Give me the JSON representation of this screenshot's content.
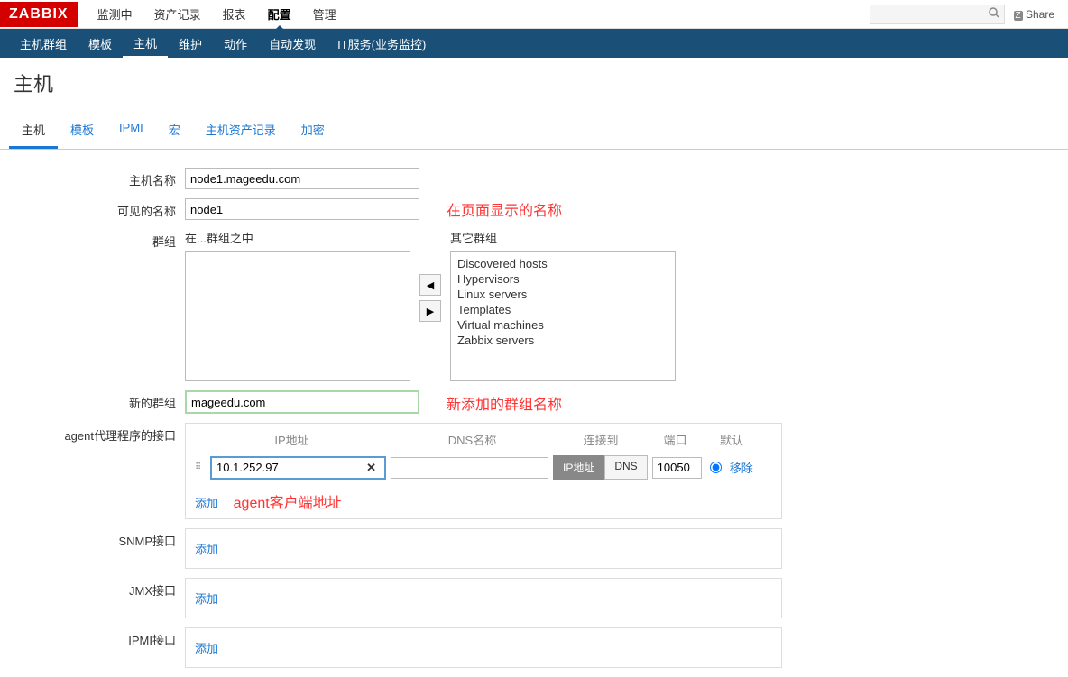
{
  "brand": "ZABBIX",
  "topnav": [
    "监测中",
    "资产记录",
    "报表",
    "配置",
    "管理"
  ],
  "topnav_active": 3,
  "share_label": "Share",
  "subnav": [
    "主机群组",
    "模板",
    "主机",
    "维护",
    "动作",
    "自动发现",
    "IT服务(业务监控)"
  ],
  "subnav_active": 2,
  "page_title": "主机",
  "tabs": [
    "主机",
    "模板",
    "IPMI",
    "宏",
    "主机资产记录",
    "加密"
  ],
  "tabs_active": 0,
  "form": {
    "host_name_label": "主机名称",
    "host_name_value": "node1.mageedu.com",
    "visible_name_label": "可见的名称",
    "visible_name_value": "node1",
    "groups_label": "群组",
    "in_groups_label": "在...群组之中",
    "other_groups_label": "其它群组",
    "other_groups": [
      "Discovered hosts",
      "Hypervisors",
      "Linux servers",
      "Templates",
      "Virtual machines",
      "Zabbix servers"
    ],
    "new_group_label": "新的群组",
    "new_group_value": "mageedu.com",
    "agent_if_label": "agent代理程序的接口",
    "headers": {
      "ip": "IP地址",
      "dns": "DNS名称",
      "conn": "连接到",
      "port": "端口",
      "def": "默认"
    },
    "agent_row": {
      "ip": "10.1.252.97",
      "conn_ip": "IP地址",
      "conn_dns": "DNS",
      "port": "10050",
      "remove": "移除"
    },
    "add_label": "添加",
    "snmp_label": "SNMP接口",
    "jmx_label": "JMX接口",
    "ipmi_label": "IPMI接口"
  },
  "annotations": {
    "visible_name": "在页面显示的名称",
    "new_group": "新添加的群组名称",
    "agent_addr": "agent客户端地址"
  }
}
